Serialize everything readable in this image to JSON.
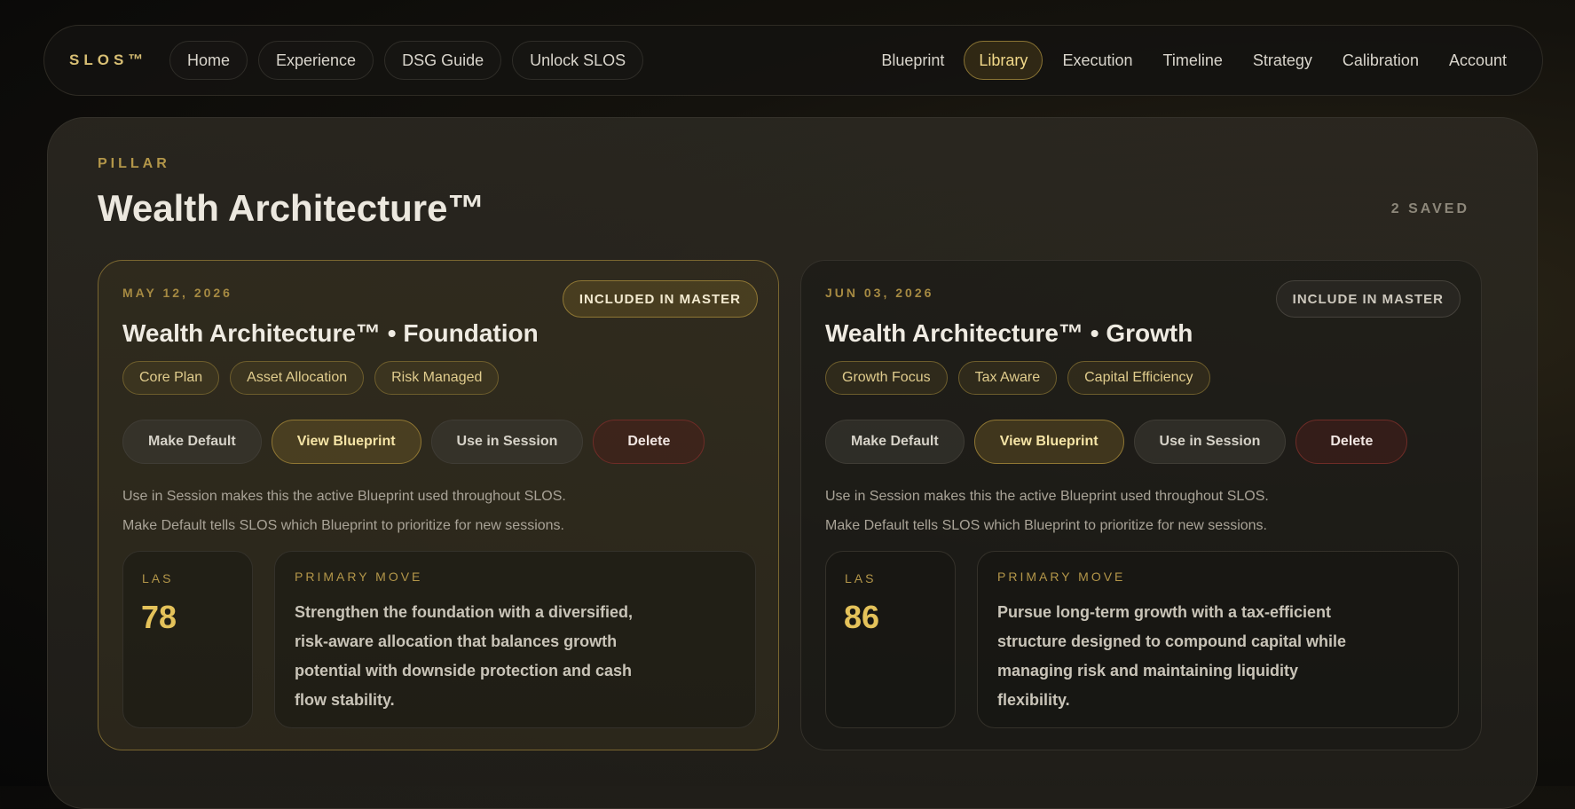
{
  "nav": {
    "brand": "SLOS™",
    "left": [
      "Home",
      "Experience",
      "DSG Guide",
      "Unlock SLOS"
    ],
    "right": [
      "Blueprint",
      "Library",
      "Execution",
      "Timeline",
      "Strategy",
      "Calibration",
      "Account"
    ],
    "active": "Library"
  },
  "page": {
    "eyebrow": "PILLAR",
    "title": "Wealth Architecture™",
    "saved": "2 SAVED"
  },
  "cards": [
    {
      "date": "MAY 12, 2026",
      "master_label": "INCLUDED IN MASTER",
      "title": "Wealth Architecture™ • Foundation",
      "tags": [
        "Core Plan",
        "Asset Allocation",
        "Risk Managed"
      ],
      "actions": [
        "Make Default",
        "View Blueprint",
        "Use in Session",
        "Delete"
      ],
      "notes": [
        "Use in Session makes this the active Blueprint used throughout SLOS.",
        "Make Default tells SLOS which Blueprint to prioritize for new sessions."
      ],
      "las_label": "LAS",
      "las_value": "78",
      "move_label": "PRIMARY MOVE",
      "move_text": "Strengthen the foundation with a diversified, risk-aware allocation that balances growth potential with downside protection and cash flow stability."
    },
    {
      "date": "JUN 03, 2026",
      "master_label": "INCLUDE IN MASTER",
      "title": "Wealth Architecture™ • Growth",
      "tags": [
        "Growth Focus",
        "Tax Aware",
        "Capital Efficiency"
      ],
      "actions": [
        "Make Default",
        "View Blueprint",
        "Use in Session",
        "Delete"
      ],
      "notes": [
        "Use in Session makes this the active Blueprint used throughout SLOS.",
        "Make Default tells SLOS which Blueprint to prioritize for new sessions."
      ],
      "las_label": "LAS",
      "las_value": "86",
      "move_label": "PRIMARY MOVE",
      "move_text": "Pursue long-term growth with a tax-efficient structure designed to compound capital while managing risk and maintaining liquidity flexibility."
    }
  ]
}
